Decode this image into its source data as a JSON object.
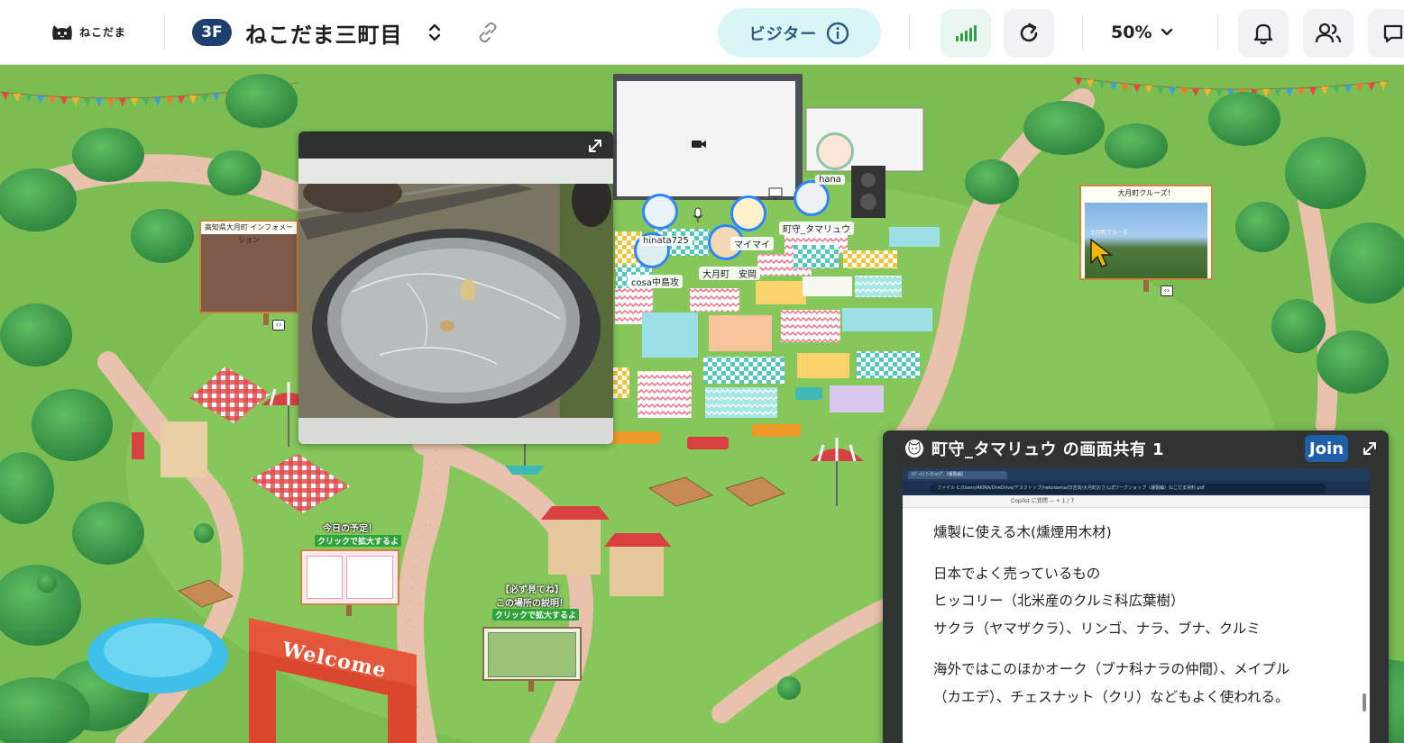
{
  "header": {
    "logo_text": "ねこだま",
    "floor_badge": "3F",
    "space_name": "ねこだま三町目",
    "visitor_label": "ビジター",
    "zoom_value": "50%"
  },
  "icons": {
    "logo": "cat-logo-icon",
    "space_toggle": "chevron-up-down-icon",
    "link": "link-icon",
    "info": "info-icon",
    "signal": "signal-bars-icon",
    "reload": "reload-icon",
    "zoom_caret": "chevron-down-icon",
    "bell": "bell-icon",
    "users": "users-icon",
    "chat": "chat-icon"
  },
  "colors": {
    "floor_badge": "#1f3f6e",
    "visitor_bg": "#d9f5f5",
    "visitor_text": "#2a5a83",
    "signal": "#2ea043",
    "avatar_ring": "#2f85ff",
    "grass": "#7bbd53",
    "path": "#e8c2ad"
  },
  "map": {
    "signs": {
      "info_board_title": "高知県大月町 インフォメーション",
      "cruise_title": "大月町クルーズ！",
      "cruise_screen_text": "大月町クルーズ",
      "schedule_title": "今日の予定！",
      "schedule_sub": "クリックで拡大するよ",
      "explain_title": "【必ず見てね】",
      "explain_title2": "この場所の説明！",
      "explain_sub": "クリックで拡大するよ",
      "welcome": "Welcome"
    },
    "avatars": [
      {
        "name": "hinata725"
      },
      {
        "name": "cosa中島攻"
      },
      {
        "name": "マイマイ"
      },
      {
        "name": "大月町　安岡"
      },
      {
        "name": "町守_タマリュウ"
      },
      {
        "name": "hana"
      }
    ]
  },
  "share": {
    "title": "町守_タマリュウ の画面共有 1",
    "join_label": "Join",
    "browser_tab": "(ﾊﾟｰﾄ) ﾜｰｸｼｮｯﾌﾟ（燻製編）",
    "address": "ファイル  C:/Users/AKIRA/OneDrive/デスクトップ/nekodama/日吉向/大月町おさんぽワークショップ（燻製編）ねこだま資料.pdf",
    "pdf_toolbar": "Copilot に質問     −   +   1 / 7",
    "doc_lines": [
      "燻製に使える木(燻煙用木材)",
      "",
      "日本でよく売っているもの",
      "ヒッコリー（北米産のクルミ科広葉樹）",
      "サクラ（ヤマザクラ）、リンゴ、ナラ、ブナ、クルミ",
      "",
      "海外ではこのほかオーク（ブナ科ナラの仲間）、メイプル",
      "（カエデ）、チェスナット（クリ）などもよく使われる。"
    ]
  }
}
